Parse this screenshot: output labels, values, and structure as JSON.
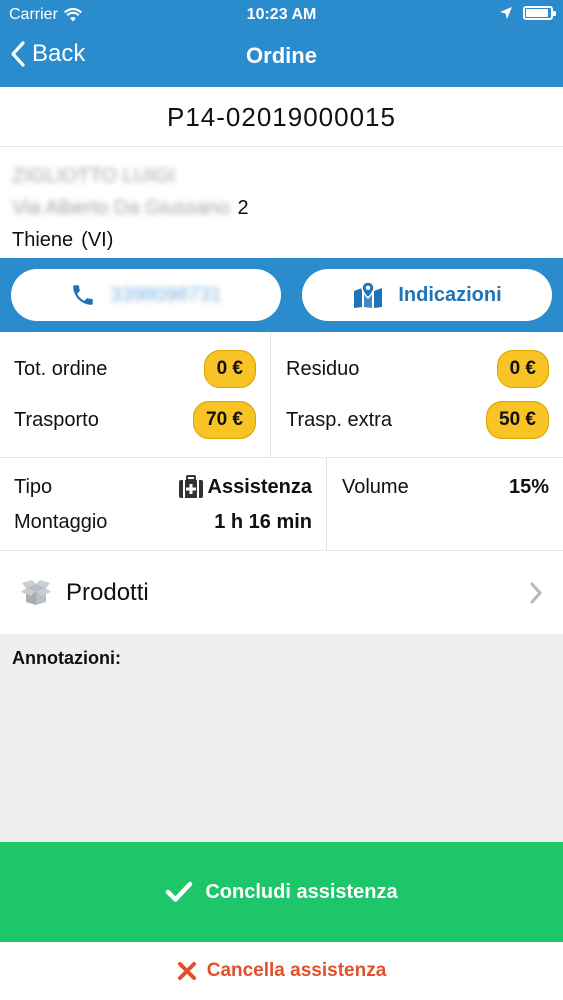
{
  "status_bar": {
    "carrier": "Carrier",
    "time": "10:23 AM",
    "battery_level": 0.9
  },
  "navbar": {
    "back_label": "Back",
    "title": "Ordine"
  },
  "order": {
    "code": "P14-02019000015"
  },
  "customer": {
    "name": "ZIGLIOTTO LUIGI",
    "street": "Via Alberto Da Giussano",
    "street_number": "2",
    "city": "Thiene",
    "province": "(VI)"
  },
  "actions": {
    "phone_number": "3398098731",
    "directions_label": "Indicazioni"
  },
  "totals": {
    "tot_ordine_label": "Tot. ordine",
    "tot_ordine_value": "0 €",
    "residuo_label": "Residuo",
    "residuo_value": "0 €",
    "trasporto_label": "Trasporto",
    "trasporto_value": "70 €",
    "trasp_extra_label": "Trasp. extra",
    "trasp_extra_value": "50 €"
  },
  "info": {
    "tipo_label": "Tipo",
    "tipo_value": "Assistenza",
    "montaggio_label": "Montaggio",
    "montaggio_value": "1 h 16 min",
    "volume_label": "Volume",
    "volume_value": "15%"
  },
  "products": {
    "label": "Prodotti"
  },
  "notes": {
    "label": "Annotazioni:"
  },
  "buttons": {
    "conclude_label": "Concludi assistenza",
    "cancel_label": "Cancella assistenza"
  },
  "colors": {
    "primary": "#2a8ccd",
    "badge": "#f7c325",
    "success": "#1ec66a",
    "danger": "#e2502a"
  }
}
